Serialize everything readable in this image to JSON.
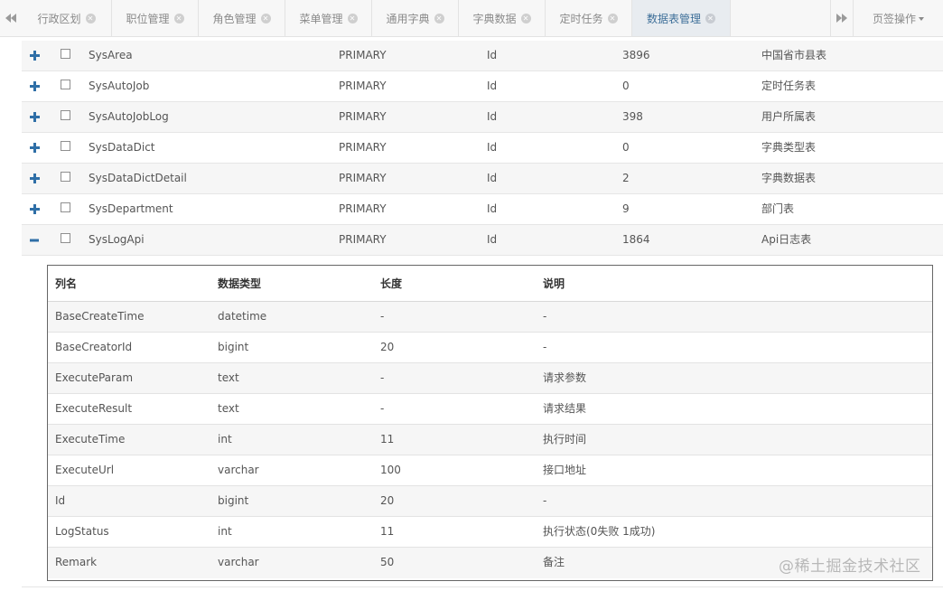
{
  "tabs": [
    {
      "label": "行政区划",
      "width": 100,
      "active": false
    },
    {
      "label": "职位管理",
      "width": 96,
      "active": false
    },
    {
      "label": "角色管理",
      "width": 96,
      "active": false
    },
    {
      "label": "菜单管理",
      "width": 96,
      "active": false
    },
    {
      "label": "通用字典",
      "width": 96,
      "active": false
    },
    {
      "label": "字典数据",
      "width": 96,
      "active": false
    },
    {
      "label": "定时任务",
      "width": 96,
      "active": false
    },
    {
      "label": "数据表管理",
      "width": 109,
      "active": true
    }
  ],
  "page_ops_label": "页签操作",
  "tables": [
    {
      "name": "SysArea",
      "pk": "PRIMARY",
      "column": "Id",
      "count": "3896",
      "desc": "中国省市县表",
      "expanded": false
    },
    {
      "name": "SysAutoJob",
      "pk": "PRIMARY",
      "column": "Id",
      "count": "0",
      "desc": "定时任务表",
      "expanded": false
    },
    {
      "name": "SysAutoJobLog",
      "pk": "PRIMARY",
      "column": "Id",
      "count": "398",
      "desc": "用户所属表",
      "expanded": false
    },
    {
      "name": "SysDataDict",
      "pk": "PRIMARY",
      "column": "Id",
      "count": "0",
      "desc": "字典类型表",
      "expanded": false
    },
    {
      "name": "SysDataDictDetail",
      "pk": "PRIMARY",
      "column": "Id",
      "count": "2",
      "desc": "字典数据表",
      "expanded": false
    },
    {
      "name": "SysDepartment",
      "pk": "PRIMARY",
      "column": "Id",
      "count": "9",
      "desc": "部门表",
      "expanded": false
    },
    {
      "name": "SysLogApi",
      "pk": "PRIMARY",
      "column": "Id",
      "count": "1864",
      "desc": "Api日志表",
      "expanded": true
    }
  ],
  "detail": {
    "headers": [
      "列名",
      "数据类型",
      "长度",
      "说明"
    ],
    "rows": [
      [
        "BaseCreateTime",
        "datetime",
        "-",
        "-"
      ],
      [
        "BaseCreatorId",
        "bigint",
        "20",
        "-"
      ],
      [
        "ExecuteParam",
        "text",
        "-",
        "请求参数"
      ],
      [
        "ExecuteResult",
        "text",
        "-",
        "请求结果"
      ],
      [
        "ExecuteTime",
        "int",
        "11",
        "执行时间"
      ],
      [
        "ExecuteUrl",
        "varchar",
        "100",
        "接口地址"
      ],
      [
        "Id",
        "bigint",
        "20",
        "-"
      ],
      [
        "LogStatus",
        "int",
        "11",
        "执行状态(0失败 1成功)"
      ],
      [
        "Remark",
        "varchar",
        "50",
        "备注"
      ]
    ]
  },
  "watermark": "@稀土掘金技术社区",
  "colors": {
    "toggle": "#2f6fa7",
    "active_tab_text": "#3e6f99"
  }
}
